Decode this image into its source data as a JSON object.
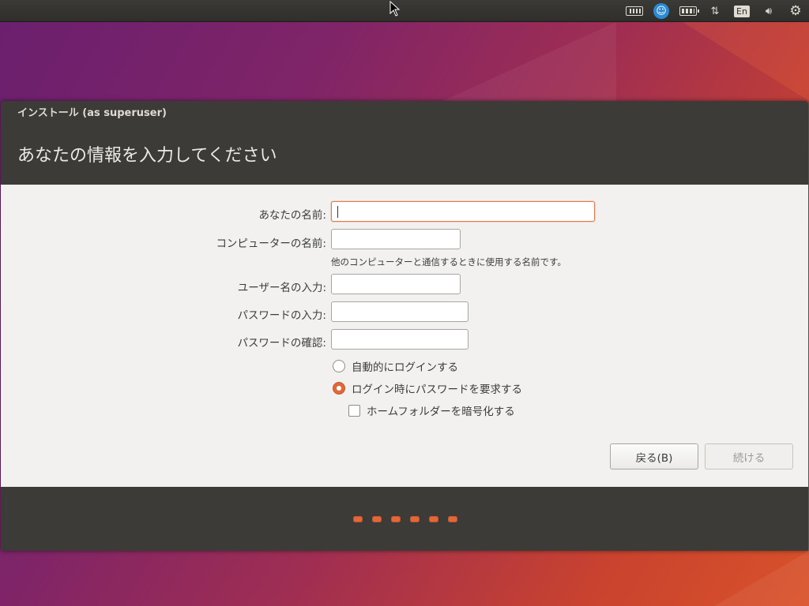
{
  "top_panel": {
    "indicators": [
      {
        "icon": "keyboard-icon"
      },
      {
        "icon": "accessibility-icon"
      },
      {
        "icon": "battery-icon"
      },
      {
        "icon": "network-icon",
        "glyph": "⇅"
      },
      {
        "icon": "input-method-icon",
        "label": "En"
      },
      {
        "icon": "volume-icon",
        "glyph": "🔊︎"
      },
      {
        "icon": "power-gear-icon",
        "glyph": "⚙"
      }
    ]
  },
  "window": {
    "title": "インストール (as superuser)",
    "heading": "あなたの情報を入力してください"
  },
  "form": {
    "name_label": "あなたの名前:",
    "name_value": "",
    "computer_label": "コンピューターの名前:",
    "computer_value": "",
    "computer_hint": "他のコンピューターと通信するときに使用する名前です。",
    "username_label": "ユーザー名の入力:",
    "username_value": "",
    "password_label": "パスワードの入力:",
    "password_value": "",
    "confirm_label": "パスワードの確認:",
    "confirm_value": "",
    "auto_login_label": "自動的にログインする",
    "require_password_label": "ログイン時にパスワードを要求する",
    "encrypt_home_label": "ホームフォルダーを暗号化する",
    "selected_login_option": "require_password",
    "encrypt_home_checked": false
  },
  "buttons": {
    "back_label": "戻る(B)",
    "continue_label": "続ける"
  },
  "progress": {
    "steps": 6
  },
  "colors": {
    "accent": "#e0693a",
    "panel": "#3c3b37"
  }
}
